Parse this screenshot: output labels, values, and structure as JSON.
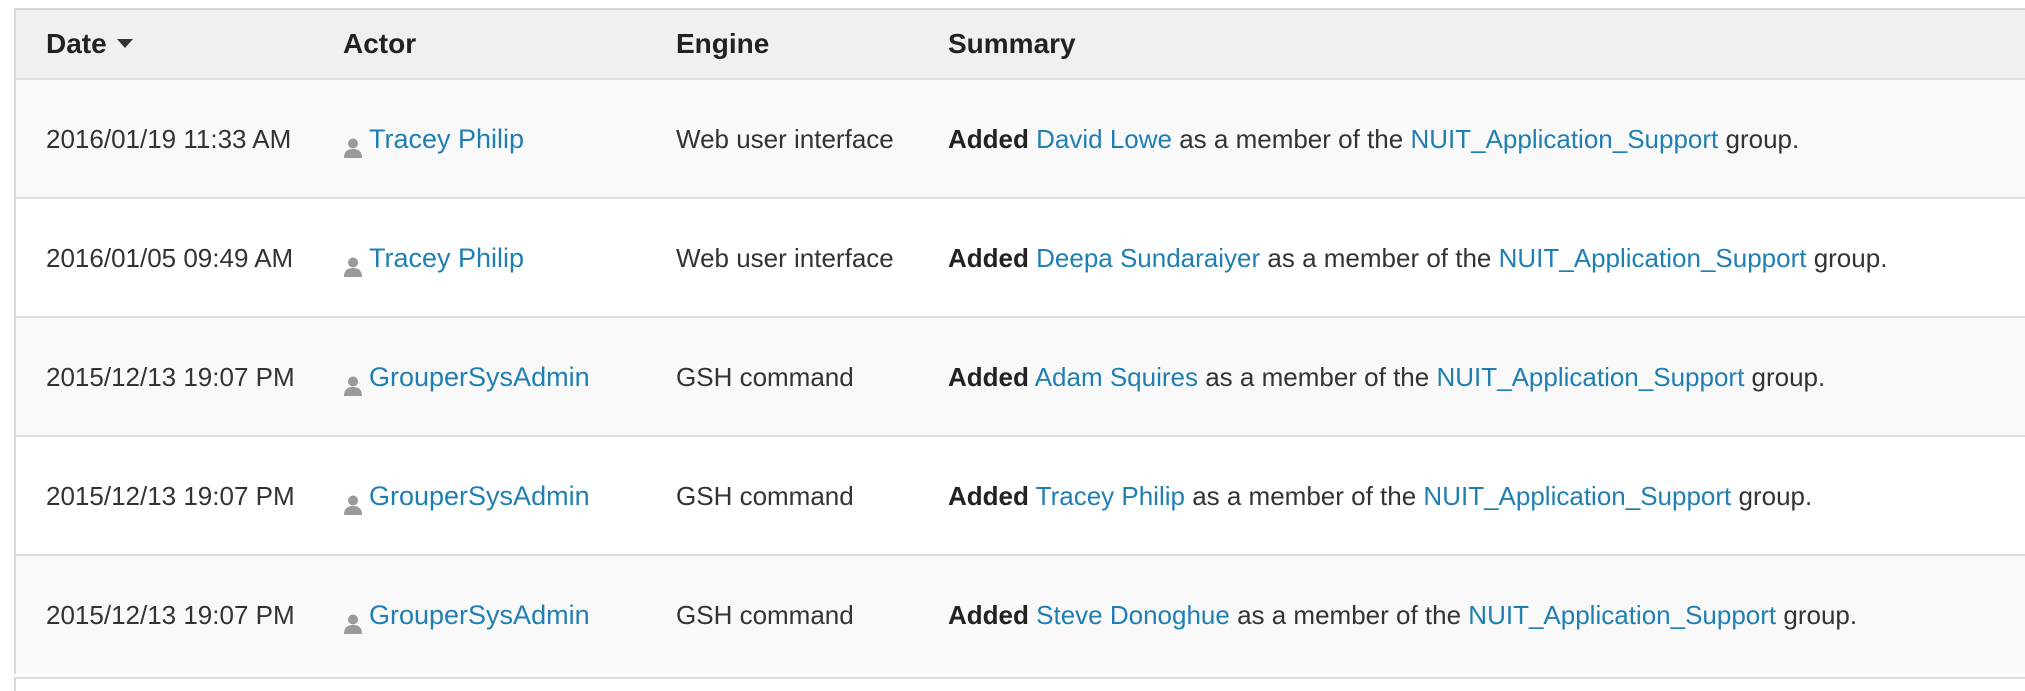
{
  "table": {
    "headers": {
      "date": "Date",
      "actor": "Actor",
      "engine": "Engine",
      "summary": "Summary"
    },
    "sort": {
      "column": "date",
      "direction": "descending",
      "icon": "caret-down-icon"
    },
    "rows": [
      {
        "date": "2016/01/19 11:33 AM",
        "actor": "Tracey Philip",
        "actor_icon": "user-icon",
        "engine": "Web user interface",
        "summary": {
          "verb": "Added",
          "subject": "David Lowe",
          "middle": " as a member of the ",
          "group": "NUIT_Application_Support",
          "end": " group."
        }
      },
      {
        "date": "2016/01/05 09:49 AM",
        "actor": "Tracey Philip",
        "actor_icon": "user-icon",
        "engine": "Web user interface",
        "summary": {
          "verb": "Added",
          "subject": "Deepa Sundaraiyer",
          "middle": " as a member of the ",
          "group": "NUIT_Application_Support",
          "end": " group."
        }
      },
      {
        "date": "2015/12/13 19:07 PM",
        "actor": "GrouperSysAdmin",
        "actor_icon": "user-icon",
        "engine": "GSH command",
        "summary": {
          "verb": "Added",
          "subject": "Adam Squires",
          "middle": " as a member of the ",
          "group": "NUIT_Application_Support",
          "end": " group."
        }
      },
      {
        "date": "2015/12/13 19:07 PM",
        "actor": "GrouperSysAdmin",
        "actor_icon": "user-icon",
        "engine": "GSH command",
        "summary": {
          "verb": "Added",
          "subject": "Tracey Philip",
          "middle": " as a member of the ",
          "group": "NUIT_Application_Support",
          "end": " group."
        }
      },
      {
        "date": "2015/12/13 19:07 PM",
        "actor": "GrouperSysAdmin",
        "actor_icon": "user-icon",
        "engine": "GSH command",
        "summary": {
          "verb": "Added",
          "subject": "Steve Donoghue",
          "middle": " as a member of the ",
          "group": "NUIT_Application_Support",
          "end": " group."
        }
      }
    ]
  },
  "colors": {
    "link": "#1f7fb3",
    "header_bg": "#f0f0f0",
    "row_stripe": "#f9f9f9",
    "text": "#333333",
    "icon": "#9a9a9a"
  }
}
